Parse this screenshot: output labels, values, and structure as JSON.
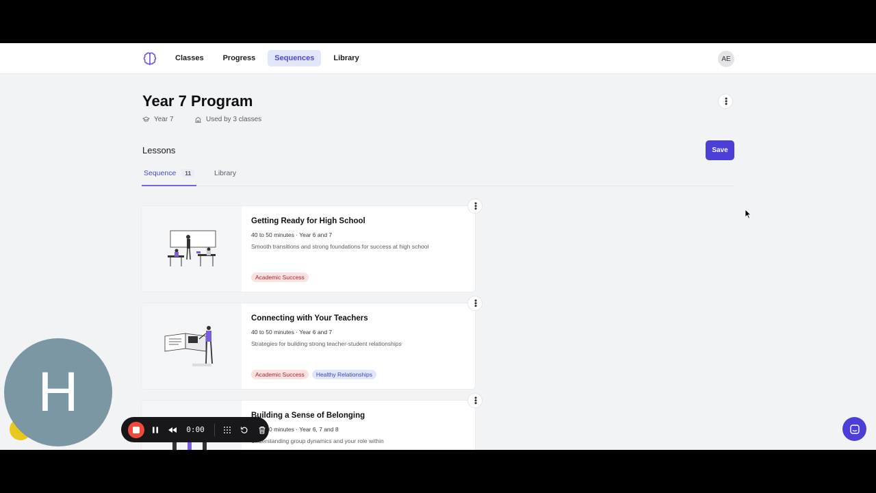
{
  "nav": {
    "items": [
      {
        "label": "Classes",
        "active": false
      },
      {
        "label": "Progress",
        "active": false
      },
      {
        "label": "Sequences",
        "active": true
      },
      {
        "label": "Library",
        "active": false
      }
    ],
    "avatar_initials": "AE"
  },
  "program": {
    "title": "Year 7 Program",
    "year_label": "Year 7",
    "used_by": "Used by 3 classes"
  },
  "lessons": {
    "heading": "Lessons",
    "save_label": "Save",
    "tabs": [
      {
        "label": "Sequence",
        "count": "11"
      },
      {
        "label": "Library"
      }
    ],
    "cards": [
      {
        "title": "Getting Ready for High School",
        "meta": "40 to 50 minutes · Year 6 and 7",
        "description": "Smooth transitions and strong foundations for success at high school",
        "tags": [
          "Academic Success"
        ]
      },
      {
        "title": "Connecting with Your Teachers",
        "meta": "40 to 50 minutes · Year 6 and 7",
        "description": "Strategies for building strong teacher-student relationships",
        "tags": [
          "Academic Success",
          "Healthy Relationships"
        ]
      },
      {
        "title": "Building a Sense of Belonging",
        "meta": "40 to 50 minutes · Year 6, 7 and 8",
        "description": "Understanding group dynamics and your role within",
        "tags": []
      }
    ]
  },
  "recorder": {
    "webcam_initial": "H",
    "time": "0:00"
  },
  "colors": {
    "brand": "#4b3fd8",
    "nav_active_bg": "#e2e6fb",
    "tag_academic_bg": "#fbe1e1",
    "tag_relationships_bg": "#e2e6fb",
    "record": "#f04a3b"
  }
}
